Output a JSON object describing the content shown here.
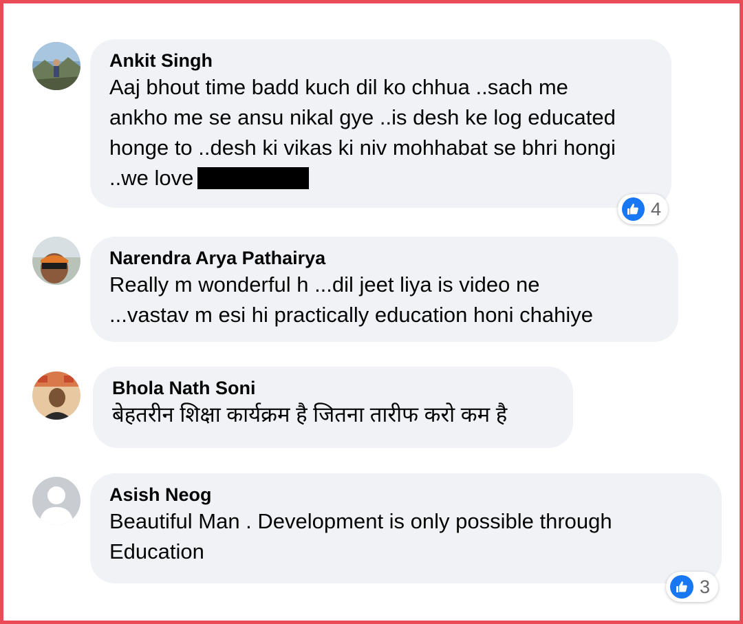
{
  "comments": [
    {
      "author": "Ankit Singh",
      "lines": [
        "Aaj bhout time badd kuch dil ko chhua ..sach me",
        "ankho me se ansu nikal gye ..is desh ke log educated",
        "honge to ..desh ki vikas ki niv mohhabat se bhri hongi",
        "..we love"
      ],
      "redacted": true,
      "reactions": {
        "icon": "like-icon",
        "count": "4"
      }
    },
    {
      "author": "Narendra Arya Pathairya",
      "lines": [
        "Really m wonderful h ...dil jeet liya is video ne",
        "...vastav m esi hi practically education honi chahiye"
      ]
    },
    {
      "author": "Bhola Nath Soni",
      "lines": [
        "बेहतरीन शिक्षा कार्यक्रम है जितना तारीफ करो कम है"
      ]
    },
    {
      "author": "Asish Neog",
      "lines": [
        "Beautiful Man . Development is only possible through",
        "Education"
      ],
      "reactions": {
        "icon": "like-icon",
        "count": "3"
      }
    }
  ],
  "colors": {
    "frame_border": "#ea4b57",
    "bubble_bg": "#f0f2f5",
    "like_blue": "#1877f2",
    "text": "#050505",
    "muted": "#65676b"
  }
}
